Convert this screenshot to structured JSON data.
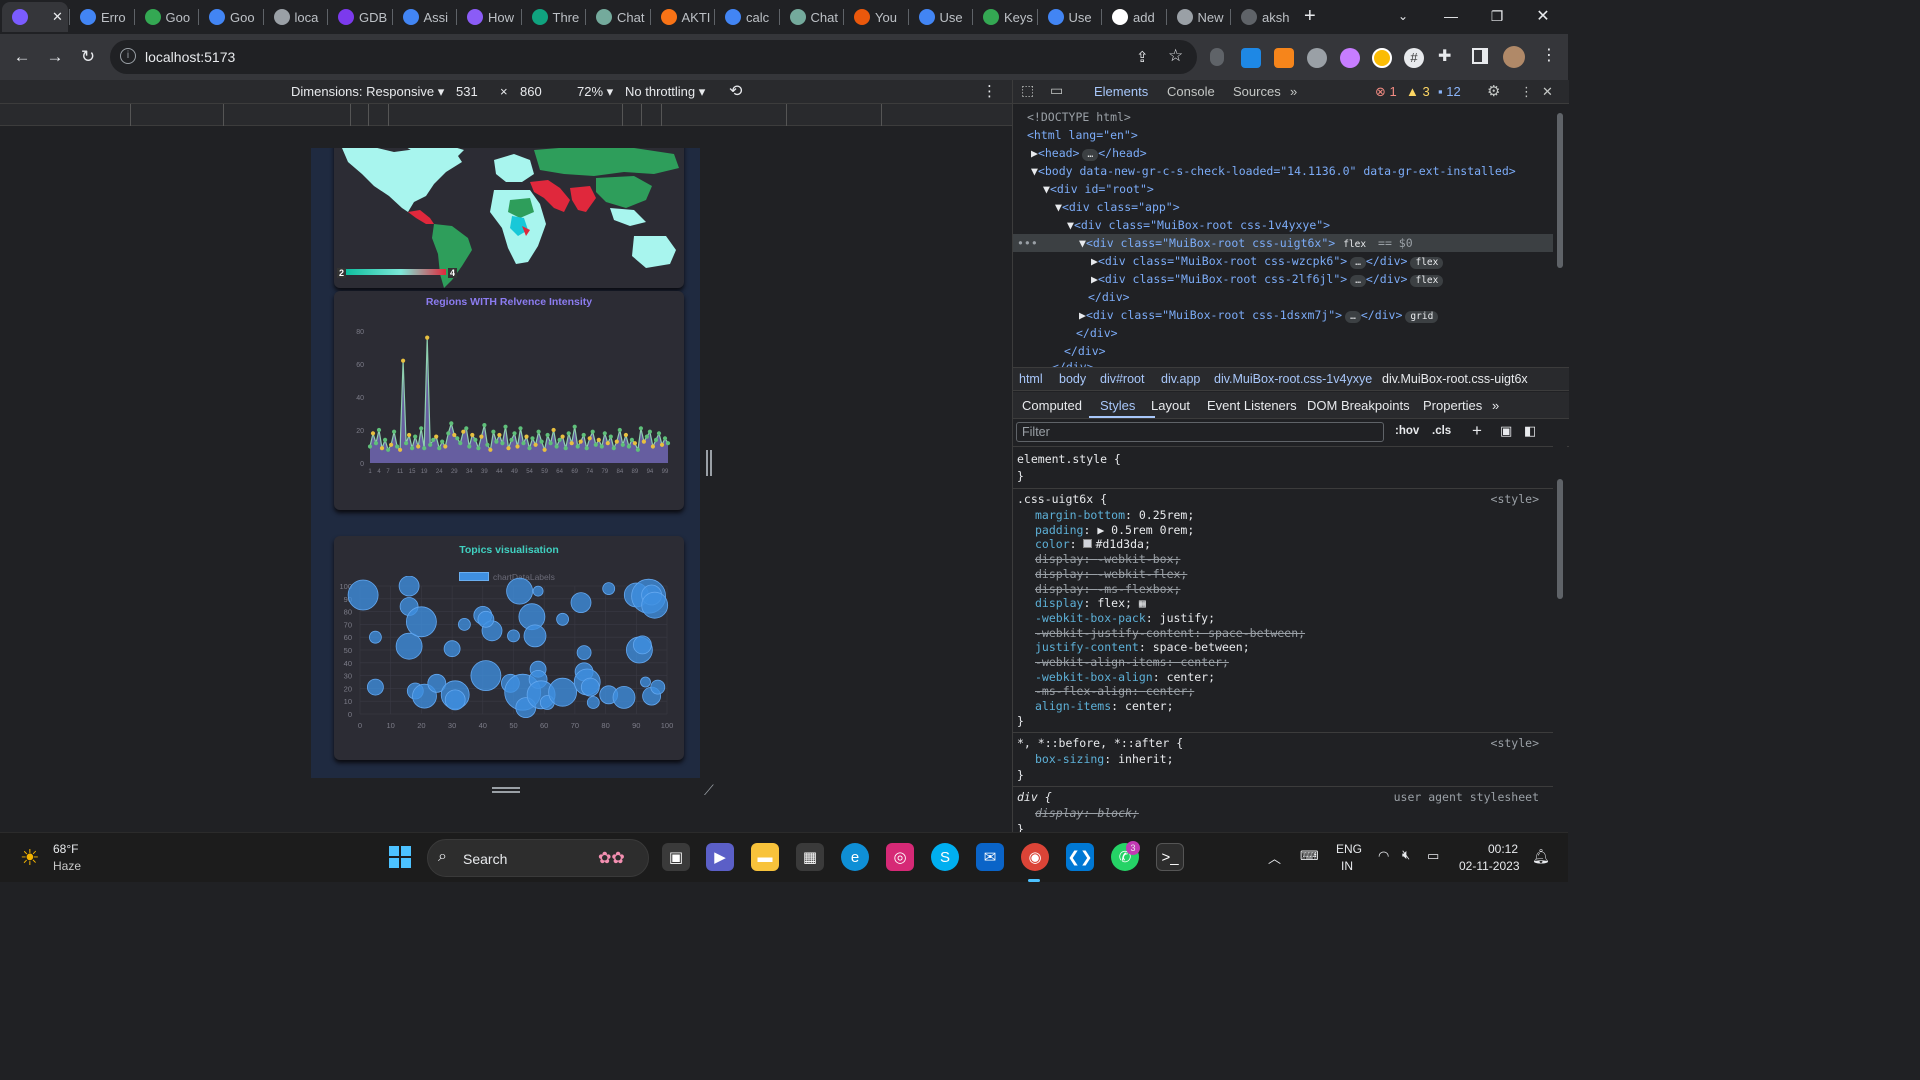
{
  "browser": {
    "tabs": [
      {
        "title": "",
        "icon": "vite-icon",
        "color": "#7b5cff"
      },
      {
        "title": "Erro",
        "icon": "google-icon",
        "color": "#4285f4"
      },
      {
        "title": "Goo",
        "icon": "maps-icon",
        "color": "#34a853"
      },
      {
        "title": "Goo",
        "icon": "google-icon",
        "color": "#4285f4"
      },
      {
        "title": "loca",
        "icon": "globe-icon",
        "color": "#9aa0a6"
      },
      {
        "title": "GDB",
        "icon": "gdb-icon",
        "color": "#7c3aed"
      },
      {
        "title": "Assi",
        "icon": "docs-icon",
        "color": "#4285f4"
      },
      {
        "title": "How",
        "icon": "c-icon",
        "color": "#8b5cf6"
      },
      {
        "title": "Thre",
        "icon": "chatgpt-icon",
        "color": "#10a37f"
      },
      {
        "title": "Chat",
        "icon": "chatgpt-icon",
        "color": "#74aa9c"
      },
      {
        "title": "AKTI",
        "icon": "aktu-icon",
        "color": "#f97316"
      },
      {
        "title": "calc",
        "icon": "google-icon",
        "color": "#4285f4"
      },
      {
        "title": "Chat",
        "icon": "chatgpt-icon",
        "color": "#74aa9c"
      },
      {
        "title": "You",
        "icon": "fire-icon",
        "color": "#ea580c"
      },
      {
        "title": "Use",
        "icon": "google-icon",
        "color": "#4285f4"
      },
      {
        "title": "Keys",
        "icon": "maps-icon",
        "color": "#34a853"
      },
      {
        "title": "Use",
        "icon": "google-icon",
        "color": "#4285f4"
      },
      {
        "title": "add",
        "icon": "github-icon",
        "color": "#ffffff"
      },
      {
        "title": "New",
        "icon": "globe-icon",
        "color": "#9aa0a6"
      },
      {
        "title": "aksh",
        "icon": "loading-icon",
        "color": "#5f6368"
      }
    ],
    "url": "localhost:5173"
  },
  "device_toolbar": {
    "dimensions": "Dimensions: Responsive",
    "width": "531",
    "times": "×",
    "height": "860",
    "zoom": "72%",
    "throttling": "No throttling"
  },
  "page": {
    "map_legend_min": "2",
    "map_legend_max": "4",
    "chart1_title": "Regions WITH Relvence Intensity",
    "chart2_title": "Topics visualisation",
    "chart2_legend": "chartDataLabels"
  },
  "chart_data": [
    {
      "type": "area",
      "title": "Regions WITH Relvence Intensity",
      "ylim": [
        0,
        80
      ],
      "yticks": [
        "0",
        "20",
        "40",
        "60",
        "80"
      ],
      "xticks": [
        "1",
        "4",
        "7",
        "11",
        "15",
        "19",
        "24",
        "29",
        "34",
        "39",
        "44",
        "49",
        "54",
        "59",
        "64",
        "69",
        "74",
        "79",
        "84",
        "89",
        "94",
        "99"
      ],
      "values": [
        10,
        18,
        12,
        20,
        9,
        14,
        8,
        11,
        19,
        10,
        8,
        62,
        12,
        17,
        9,
        16,
        10,
        21,
        9,
        76,
        11,
        14,
        16,
        9,
        13,
        10,
        18,
        24,
        17,
        15,
        12,
        19,
        21,
        10,
        17,
        14,
        9,
        16,
        23,
        11,
        8,
        19,
        13,
        17,
        12,
        22,
        9,
        14,
        18,
        10,
        21,
        12,
        16,
        9,
        15,
        11,
        19,
        13,
        8,
        17,
        12,
        20,
        10,
        14,
        16,
        9,
        18,
        12,
        22,
        10,
        13,
        17,
        9,
        15,
        19,
        11,
        14,
        10,
        18,
        12,
        16,
        9,
        13,
        20,
        11,
        17,
        10,
        14,
        12,
        8,
        21,
        13,
        16,
        19,
        10,
        14,
        18,
        11,
        15,
        12
      ]
    },
    {
      "type": "scatter",
      "title": "Topics visualisation",
      "legend": "chartDataLabels",
      "xlim": [
        0,
        100
      ],
      "ylim": [
        0,
        100
      ],
      "xticks": [
        "0",
        "10",
        "20",
        "30",
        "40",
        "50",
        "60",
        "70",
        "80",
        "90",
        "100"
      ],
      "yticks": [
        "0",
        "10",
        "20",
        "30",
        "40",
        "50",
        "60",
        "70",
        "80",
        "90",
        "100"
      ],
      "points": [
        {
          "x": 1,
          "y": 93,
          "r": 15
        },
        {
          "x": 5,
          "y": 60,
          "r": 6
        },
        {
          "x": 5,
          "y": 21,
          "r": 8
        },
        {
          "x": 16,
          "y": 100,
          "r": 10
        },
        {
          "x": 16,
          "y": 84,
          "r": 9
        },
        {
          "x": 16,
          "y": 53,
          "r": 13
        },
        {
          "x": 20,
          "y": 72,
          "r": 15
        },
        {
          "x": 18,
          "y": 18,
          "r": 8
        },
        {
          "x": 21,
          "y": 14,
          "r": 12
        },
        {
          "x": 25,
          "y": 24,
          "r": 9
        },
        {
          "x": 30,
          "y": 51,
          "r": 8
        },
        {
          "x": 31,
          "y": 15,
          "r": 14
        },
        {
          "x": 31,
          "y": 11,
          "r": 10
        },
        {
          "x": 34,
          "y": 70,
          "r": 6
        },
        {
          "x": 40,
          "y": 77,
          "r": 9
        },
        {
          "x": 43,
          "y": 65,
          "r": 10
        },
        {
          "x": 41,
          "y": 30,
          "r": 15
        },
        {
          "x": 41,
          "y": 74,
          "r": 8
        },
        {
          "x": 49,
          "y": 24,
          "r": 9
        },
        {
          "x": 50,
          "y": 61,
          "r": 6
        },
        {
          "x": 52,
          "y": 96,
          "r": 13
        },
        {
          "x": 53,
          "y": 17,
          "r": 18
        },
        {
          "x": 54,
          "y": 5,
          "r": 10
        },
        {
          "x": 56,
          "y": 76,
          "r": 13
        },
        {
          "x": 57,
          "y": 61,
          "r": 11
        },
        {
          "x": 58,
          "y": 96,
          "r": 5
        },
        {
          "x": 58,
          "y": 35,
          "r": 8
        },
        {
          "x": 58,
          "y": 27,
          "r": 9
        },
        {
          "x": 59,
          "y": 15,
          "r": 14
        },
        {
          "x": 61,
          "y": 9,
          "r": 7
        },
        {
          "x": 66,
          "y": 74,
          "r": 6
        },
        {
          "x": 66,
          "y": 17,
          "r": 14
        },
        {
          "x": 72,
          "y": 87,
          "r": 10
        },
        {
          "x": 73,
          "y": 48,
          "r": 7
        },
        {
          "x": 73,
          "y": 33,
          "r": 9
        },
        {
          "x": 74,
          "y": 25,
          "r": 13
        },
        {
          "x": 75,
          "y": 21,
          "r": 9
        },
        {
          "x": 76,
          "y": 9,
          "r": 6
        },
        {
          "x": 81,
          "y": 15,
          "r": 9
        },
        {
          "x": 81,
          "y": 98,
          "r": 6
        },
        {
          "x": 86,
          "y": 13,
          "r": 11
        },
        {
          "x": 90,
          "y": 93,
          "r": 12
        },
        {
          "x": 91,
          "y": 50,
          "r": 13
        },
        {
          "x": 92,
          "y": 54,
          "r": 9
        },
        {
          "x": 93,
          "y": 25,
          "r": 5
        },
        {
          "x": 94,
          "y": 92,
          "r": 17
        },
        {
          "x": 95,
          "y": 93,
          "r": 10
        },
        {
          "x": 95,
          "y": 14,
          "r": 9
        },
        {
          "x": 96,
          "y": 85,
          "r": 13
        },
        {
          "x": 97,
          "y": 21,
          "r": 7
        }
      ]
    }
  ],
  "devtools": {
    "tabs": [
      "Elements",
      "Console",
      "Sources"
    ],
    "errors": "1",
    "warnings": "3",
    "messages": "12",
    "dom_lines": [
      "<!DOCTYPE html>",
      "<html lang=\"en\">",
      "<head>",
      "</head>",
      "<body data-new-gr-c-s-check-loaded=\"14.1136.0\" data-gr-ext-installed>",
      "<div id=\"root\">",
      "<div class=\"app\">",
      "<div class=\"MuiBox-root css-1v4yxye\">",
      "<div class=\"MuiBox-root css-uigt6x\">",
      "flex",
      "== $0",
      "<div class=\"MuiBox-root css-wzcpk6\">",
      "</div>",
      "flex",
      "<div class=\"MuiBox-root css-2lf6jl\">",
      "</div>",
      "flex",
      "</div>",
      "<div class=\"MuiBox-root css-1dsxm7j\">",
      "</div>",
      "grid",
      "</div>",
      "</div>",
      "</div>"
    ],
    "breadcrumbs": [
      "html",
      "body",
      "div#root",
      "div.app",
      "div.MuiBox-root.css-1v4yxye",
      "div.MuiBox-root.css-uigt6x"
    ],
    "subtabs": [
      "Computed",
      "Styles",
      "Layout",
      "Event Listeners",
      "DOM Breakpoints",
      "Properties"
    ],
    "filter_placeholder": "Filter",
    "hov": ":hov",
    "cls": ".cls",
    "styles": {
      "element_style": "element.style {",
      "close": "}",
      "rule1_selector": ".css-uigt6x {",
      "rule1_source": "<style>",
      "rule1_props": [
        {
          "p": "margin-bottom",
          "v": "0.25rem;",
          "s": false
        },
        {
          "p": "padding",
          "v": "▶ 0.5rem 0rem;",
          "s": false
        },
        {
          "p": "color",
          "v": "#d1d3da;",
          "s": false
        },
        {
          "p": "display",
          "v": "-webkit-box;",
          "s": true
        },
        {
          "p": "display",
          "v": "-webkit-flex;",
          "s": true
        },
        {
          "p": "display",
          "v": "-ms-flexbox;",
          "s": true
        },
        {
          "p": "display",
          "v": "flex;",
          "s": false
        },
        {
          "p": "-webkit-box-pack",
          "v": "justify;",
          "s": false
        },
        {
          "p": "-webkit-justify-content",
          "v": "space-between;",
          "s": true
        },
        {
          "p": "justify-content",
          "v": "space-between;",
          "s": false
        },
        {
          "p": "-webkit-align-items",
          "v": "center;",
          "s": true
        },
        {
          "p": "-webkit-box-align",
          "v": "center;",
          "s": false
        },
        {
          "p": "-ms-flex-align",
          "v": "center;",
          "s": true
        },
        {
          "p": "align-items",
          "v": "center;",
          "s": false
        }
      ],
      "rule2_selector": "*, *::before, *::after {",
      "rule2_source": "<style>",
      "rule2_prop": "box-sizing",
      "rule2_value": "inherit;",
      "rule3_selector": "div {",
      "rule3_source": "user agent stylesheet",
      "rule3_prop": "display",
      "rule3_value": "block;"
    }
  },
  "taskbar": {
    "temp": "68°F",
    "weather": "Haze",
    "search": "Search",
    "lang1": "ENG",
    "lang2": "IN",
    "time": "00:12",
    "date": "02-11-2023",
    "whatsapp_badge": "3"
  },
  "colors": {
    "accent": "#a8c7fa",
    "map_green": "#2e9e5b",
    "map_cyan": "#a8f5ee",
    "map_red": "#e0283c",
    "area_fill": "#7a6fc4",
    "bubble": "#3f8fe0",
    "chart1_title": "#8c7cf0",
    "chart2_title": "#40d0c0"
  }
}
